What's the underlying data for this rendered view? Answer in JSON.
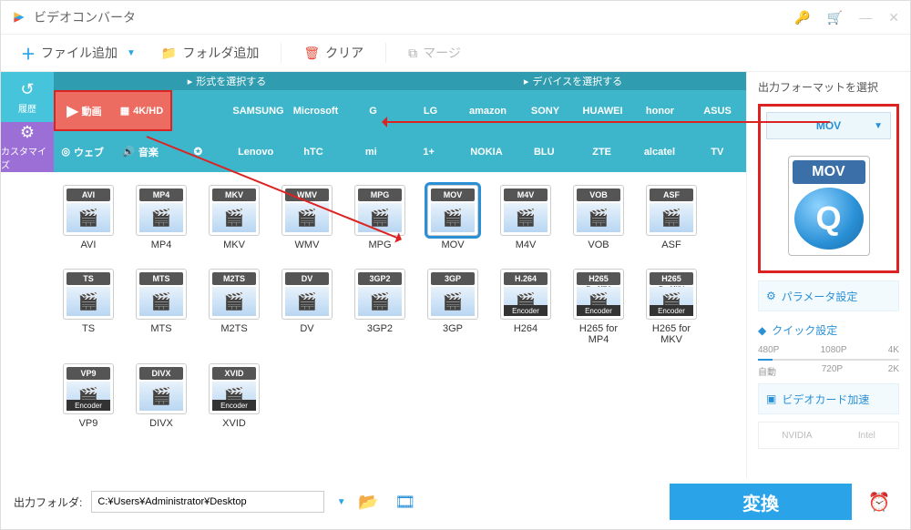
{
  "title": "ビデオコンバータ",
  "toolbar": {
    "add_file": "ファイル追加",
    "add_folder": "フォルダ追加",
    "clear": "クリア",
    "merge": "マージ"
  },
  "leftbar": {
    "history": "履歴",
    "custom": "カスタマイズ"
  },
  "tabs": {
    "format": "形式を選択する",
    "device": "デバイスを選択する"
  },
  "row1": {
    "video": "動画",
    "hd": "4K/HD",
    "brands": [
      "",
      "SAMSUNG",
      "Microsoft",
      "G",
      "LG",
      "amazon",
      "SONY",
      "HUAWEI",
      "honor",
      "ASUS"
    ]
  },
  "row2": {
    "web": "ウェブ",
    "audio": "音楽",
    "brands": [
      "",
      "Lenovo",
      "hTC",
      "mi",
      "1+",
      "NOKIA",
      "BLU",
      "ZTE",
      "alcatel",
      "TV"
    ]
  },
  "formats": [
    {
      "band": "AVI",
      "label": "AVI",
      "sel": false
    },
    {
      "band": "MP4",
      "label": "MP4",
      "sel": false
    },
    {
      "band": "MKV",
      "label": "MKV",
      "sel": false
    },
    {
      "band": "WMV",
      "label": "WMV",
      "sel": false
    },
    {
      "band": "MPG",
      "label": "MPG",
      "sel": false
    },
    {
      "band": "MOV",
      "label": "MOV",
      "sel": true
    },
    {
      "band": "M4V",
      "label": "M4V",
      "sel": false
    },
    {
      "band": "VOB",
      "label": "VOB",
      "sel": false
    },
    {
      "band": "ASF",
      "label": "ASF",
      "sel": false
    },
    {
      "band": "TS",
      "label": "TS",
      "sel": false
    },
    {
      "band": "MTS",
      "label": "MTS",
      "sel": false
    },
    {
      "band": "M2TS",
      "label": "M2TS",
      "sel": false
    },
    {
      "band": "DV",
      "label": "DV",
      "sel": false
    },
    {
      "band": "3GP2",
      "label": "3GP2",
      "sel": false
    },
    {
      "band": "3GP",
      "label": "3GP",
      "sel": false
    },
    {
      "band": "H.264",
      "label": "H264",
      "enc": "Encoder",
      "sel": false
    },
    {
      "band": "H265",
      "label": "H265 for MP4",
      "sub": "For MP4",
      "enc": "Encoder",
      "sel": false
    },
    {
      "band": "H265",
      "label": "H265 for MKV",
      "sub": "For MKV",
      "enc": "Encoder",
      "sel": false
    },
    {
      "band": "VP9",
      "label": "VP9",
      "enc": "Encoder",
      "sel": false
    },
    {
      "band": "DIVX",
      "label": "DIVX",
      "sel": false
    },
    {
      "band": "XVID",
      "label": "XVID",
      "enc": "Encoder",
      "sel": false
    }
  ],
  "rightpane": {
    "title": "出力フォーマットを選択",
    "selected": "MOV",
    "param": "パラメータ設定",
    "quick": "クイック設定",
    "ticks_top": [
      "480P",
      "1080P",
      "4K"
    ],
    "ticks_bot": [
      "自動",
      "720P",
      "2K"
    ],
    "gpu": "ビデオカード加速",
    "nvidia": "NVIDIA",
    "intel": "Intel"
  },
  "footer": {
    "label": "出力フォルダ:",
    "path": "C:¥Users¥Administrator¥Desktop",
    "convert": "変換"
  }
}
